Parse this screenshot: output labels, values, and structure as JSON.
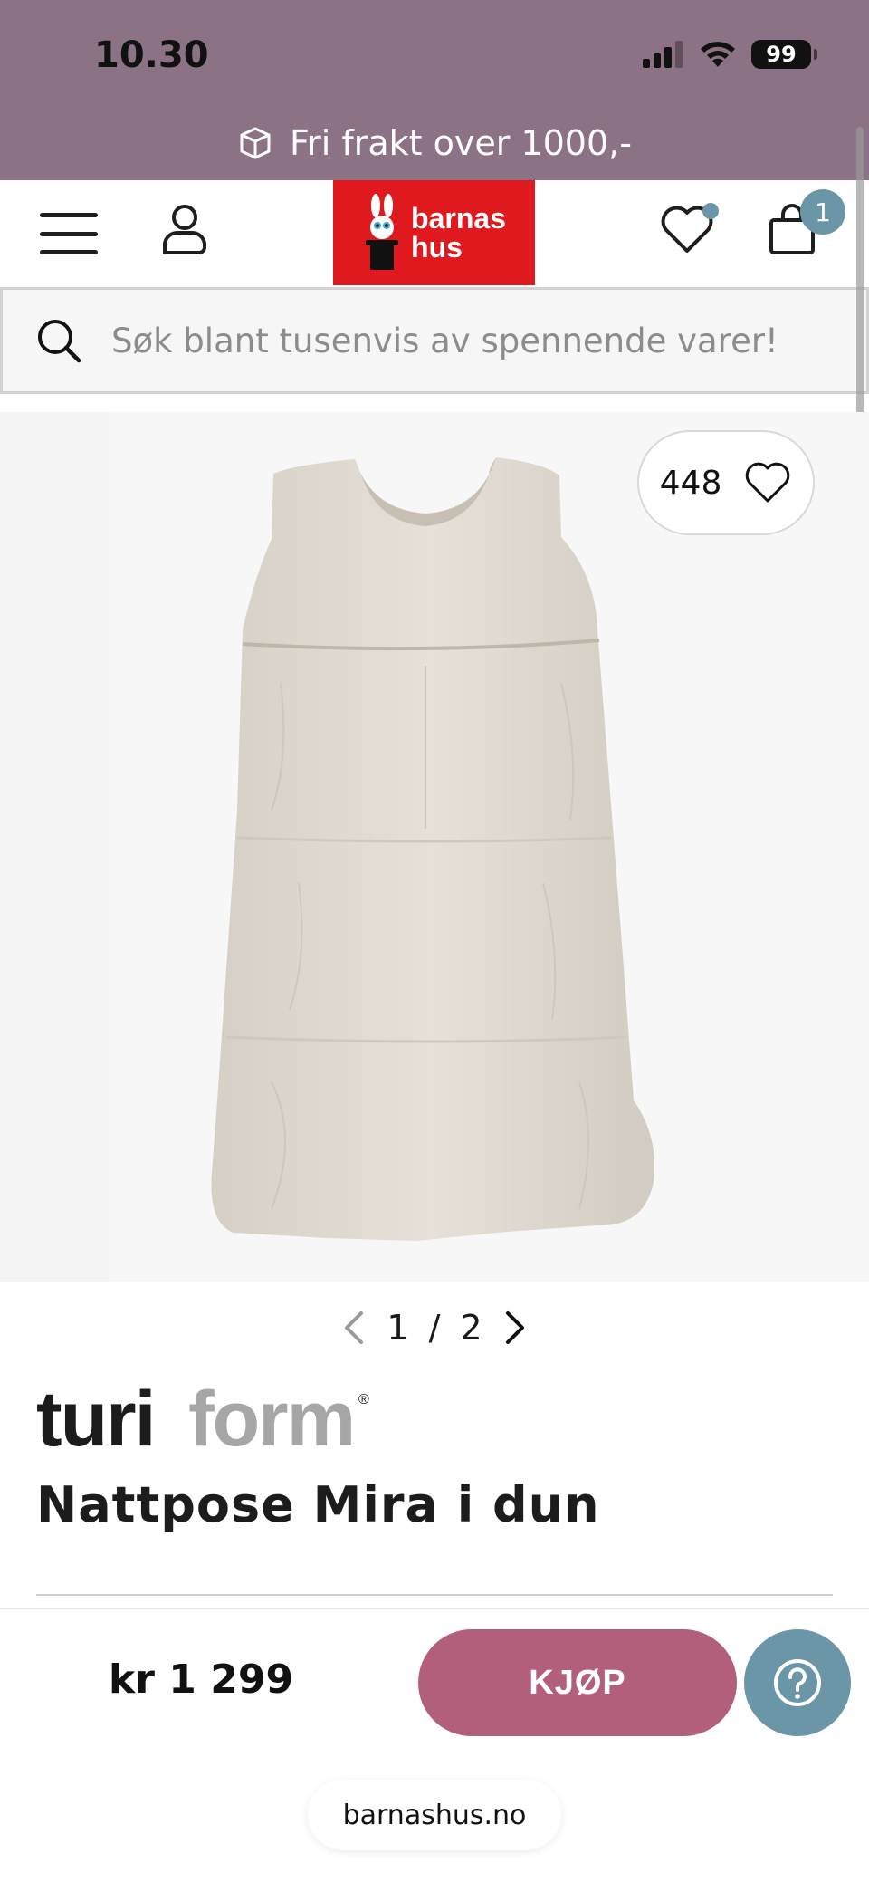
{
  "status_bar": {
    "time": "10.30",
    "battery": "99"
  },
  "promo": {
    "text": "Fri frakt over 1000,-",
    "icon": "package-icon"
  },
  "header": {
    "logo_line1": "barnas",
    "logo_line2": "hus",
    "cart_count": "1",
    "icons": [
      "menu-icon",
      "user-icon",
      "heart-icon",
      "shopping-bag-icon"
    ],
    "colors": {
      "brand_red": "#e0191e",
      "accent_blue": "#6b96a8",
      "top_band": "#8c7285"
    }
  },
  "search": {
    "placeholder": "Søk blant tusenvis av spennende varer!"
  },
  "gallery": {
    "likes": "448",
    "current": "1",
    "separator": "/",
    "total": "2"
  },
  "product": {
    "brand_dark": "turi",
    "brand_light": "form",
    "brand_mark": "®",
    "name": "Nattpose Mira i dun"
  },
  "purchase": {
    "price": "kr 1 299",
    "buy_label": "KJØP",
    "buy_color": "#b25f7c"
  },
  "browser": {
    "url": "barnashus.no"
  }
}
